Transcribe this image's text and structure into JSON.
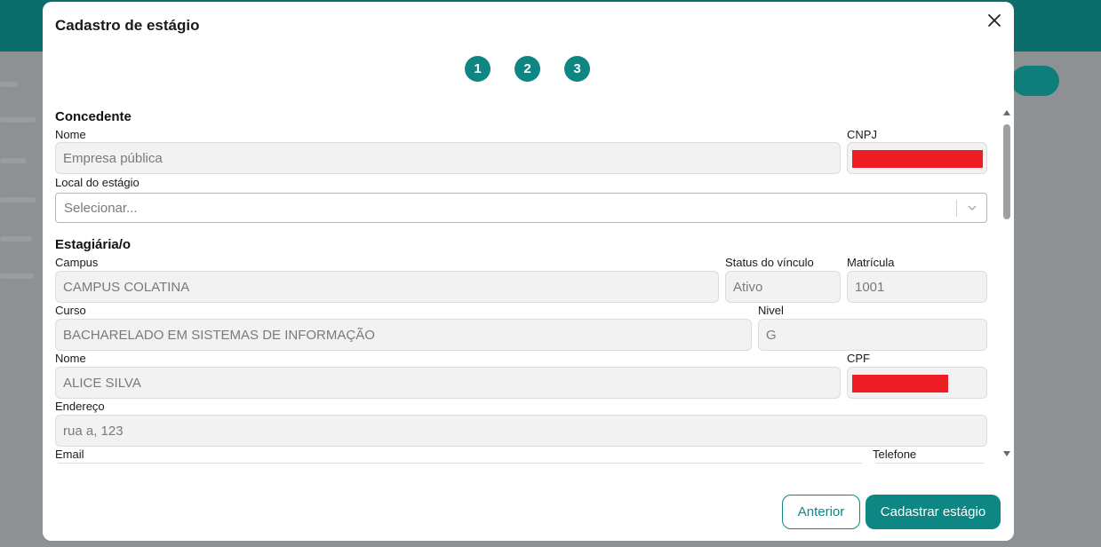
{
  "modal": {
    "title": "Cadastro de estágio",
    "steps": [
      "1",
      "2",
      "3"
    ]
  },
  "concedente": {
    "section_title": "Concedente",
    "nome_label": "Nome",
    "nome_value": "Empresa pública",
    "cnpj_label": "CNPJ",
    "local_label": "Local do estágio",
    "local_placeholder": "Selecionar..."
  },
  "estagiario": {
    "section_title": "Estagiária/o",
    "campus_label": "Campus",
    "campus_value": "CAMPUS COLATINA",
    "status_label": "Status do vínculo",
    "status_value": "Ativo",
    "matricula_label": "Matrícula",
    "matricula_value": "1001",
    "curso_label": "Curso",
    "curso_value": "BACHARELADO EM SISTEMAS DE INFORMAÇÃO",
    "nivel_label": "Nivel",
    "nivel_value": "G",
    "nome_label": "Nome",
    "nome_value": "ALICE SILVA",
    "cpf_label": "CPF",
    "endereco_label": "Endereço",
    "endereco_value": "rua a, 123",
    "email_label": "Email",
    "telefone_label": "Telefone"
  },
  "footer": {
    "prev_label": "Anterior",
    "submit_label": "Cadastrar estágio"
  },
  "colors": {
    "accent": "#0e8683",
    "redaction": "#ee1c24"
  }
}
